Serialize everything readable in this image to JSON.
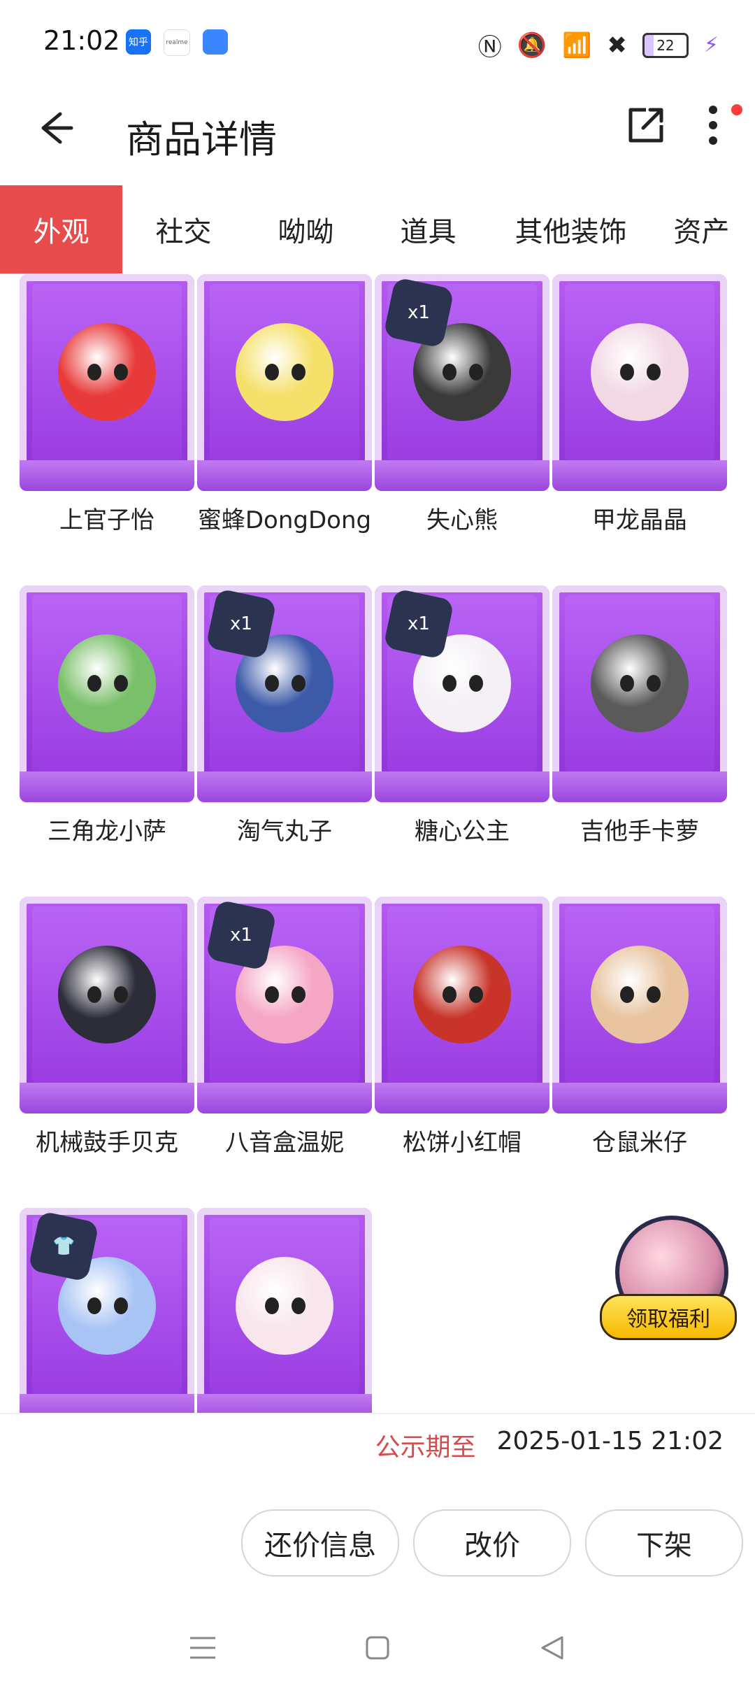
{
  "status": {
    "time": "21:02",
    "app_icons": [
      {
        "name": "zhihu",
        "label": "知乎",
        "color": "#1772f6"
      },
      {
        "name": "realme",
        "label": "realme",
        "color": "#ffffff"
      },
      {
        "name": "blue-app",
        "label": "",
        "color": "#3a86ff"
      }
    ],
    "battery": "22"
  },
  "header": {
    "title": "商品详情"
  },
  "tabs": [
    "外观",
    "社交",
    "呦呦",
    "道具",
    "其他装饰",
    "资产"
  ],
  "items": [
    {
      "name": "上官子怡",
      "badge": "",
      "color": "#e83a3a"
    },
    {
      "name": "蜜蜂DongDong",
      "badge": "",
      "color": "#f5e06a"
    },
    {
      "name": "失心熊",
      "badge": "x1",
      "color": "#3a3a3a"
    },
    {
      "name": "甲龙晶晶",
      "badge": "",
      "color": "#f2d8e4"
    },
    {
      "name": "三角龙小萨",
      "badge": "",
      "color": "#7ac06a"
    },
    {
      "name": "淘气丸子",
      "badge": "x1",
      "color": "#3c5aa8"
    },
    {
      "name": "糖心公主",
      "badge": "x1",
      "color": "#f4f0f6"
    },
    {
      "name": "吉他手卡萝",
      "badge": "",
      "color": "#5a5a5a"
    },
    {
      "name": "机械鼓手贝克",
      "badge": "",
      "color": "#2d2d3a"
    },
    {
      "name": "八音盒温妮",
      "badge": "x1",
      "color": "#f5a6c4"
    },
    {
      "name": "松饼小红帽",
      "badge": "",
      "color": "#c8342a"
    },
    {
      "name": "仓鼠米仔",
      "badge": "",
      "color": "#e8c4a0"
    },
    {
      "name": "",
      "badge": "shirt",
      "color": "#a8c4f5"
    },
    {
      "name": "",
      "badge": "",
      "color": "#f8e6ec"
    }
  ],
  "welfare": {
    "label": "领取福利"
  },
  "deadline": {
    "label": "公示期至",
    "value": "2025-01-15 21:02"
  },
  "actions": {
    "counter": "还价信息",
    "reprice": "改价",
    "delist": "下架"
  }
}
